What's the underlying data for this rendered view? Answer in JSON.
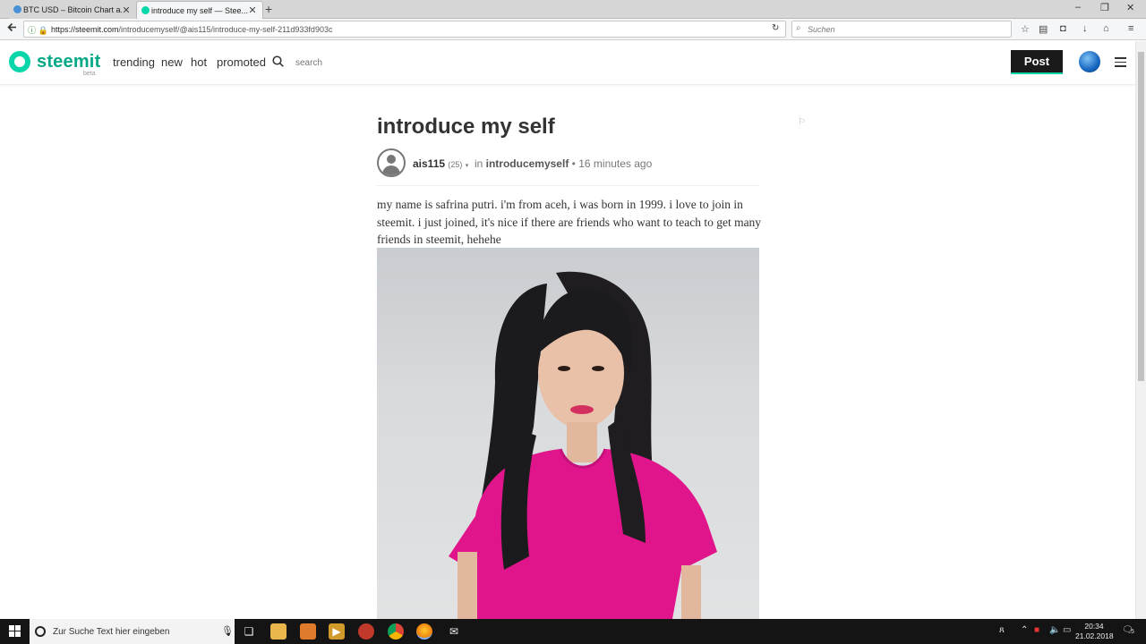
{
  "browser": {
    "tabs": [
      {
        "title": "BTC USD – Bitcoin Chart a...",
        "active": false,
        "favicon_color": "#4a90d9"
      },
      {
        "title": "introduce my self — Stee...",
        "active": true,
        "favicon_color": "#06d6a9"
      }
    ],
    "close_glyph": "✕",
    "new_tab_glyph": "+",
    "window_controls": [
      "–",
      "❐",
      "✕"
    ],
    "url_host": "https://steemit.com",
    "url_path": "/introducemyself/@ais115/introduce-my-self-211d933fd903c",
    "search_placeholder": "Suchen"
  },
  "site": {
    "logo_text": "steemit",
    "beta_label": "beta",
    "nav": [
      "trending",
      "new",
      "hot",
      "promoted"
    ],
    "search_placeholder": "search",
    "post_button": "Post",
    "accent_color": "#06d6a9"
  },
  "article": {
    "title": "introduce my self",
    "author": "ais115",
    "reputation": "(25)",
    "in_label": "in",
    "category": "introducemyself",
    "time_ago": "16 minutes ago",
    "body": "my name is safrina putri. i'm from aceh, i was born in 1999. i love to join in steemit. i just joined, it's nice if there are friends who want to teach to get many friends in steemit, hehehe"
  },
  "taskbar": {
    "search_text": "Zur Suche Text hier eingeben",
    "time": "20:34",
    "date": "21.02.2018",
    "notification_count": "5"
  }
}
